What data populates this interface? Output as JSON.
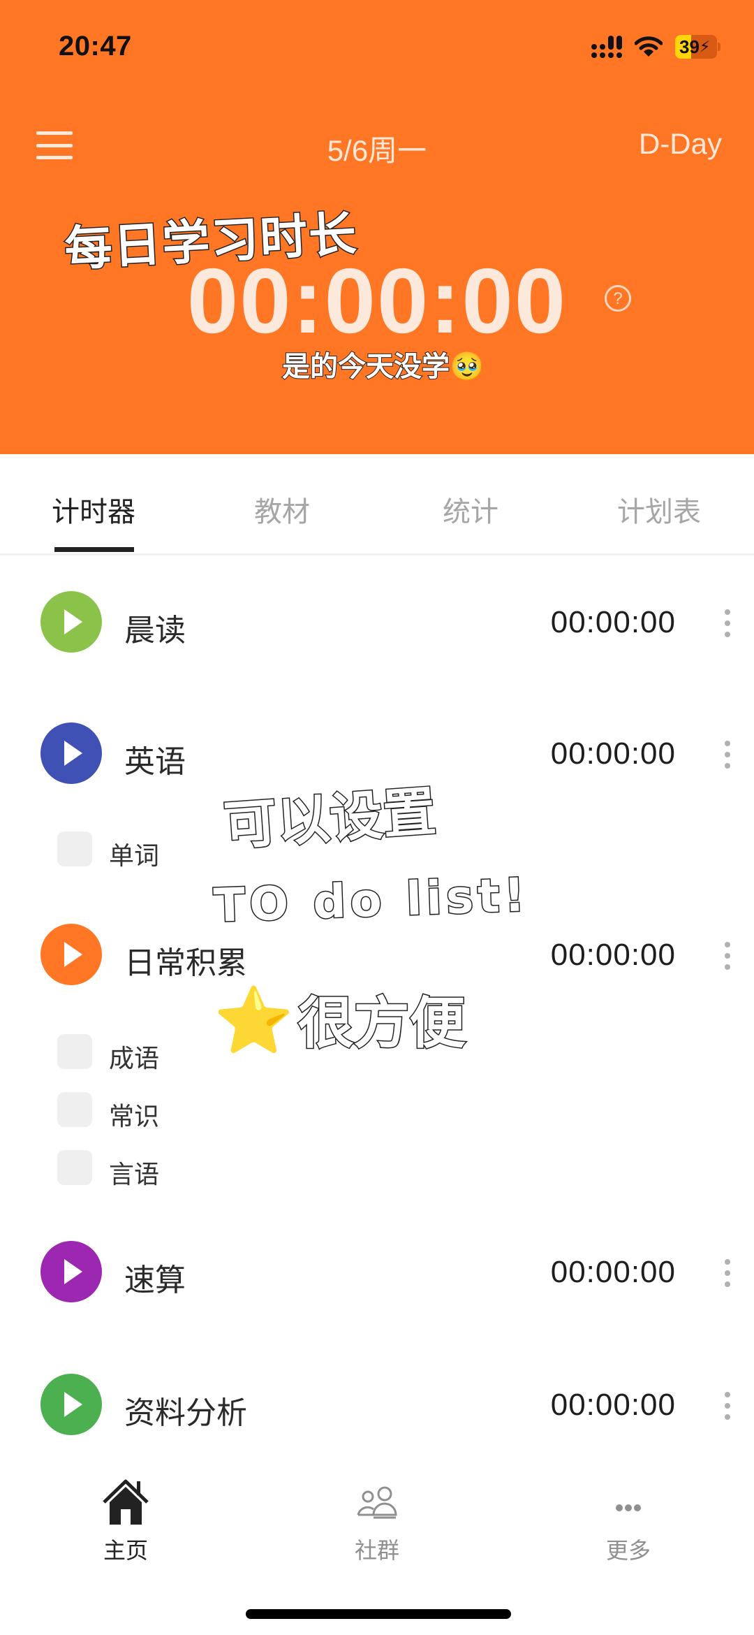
{
  "status_bar": {
    "time": "20:47",
    "battery_level": "39",
    "battery_fraction": 0.39,
    "signal_icon": "cellular-signal-icon",
    "wifi_icon": "wifi-icon",
    "charging_icon": "bolt-icon"
  },
  "header": {
    "menu_icon": "hamburger-menu-icon",
    "date_title": "5/6周一",
    "dday_label": "D-Day",
    "total_time": "00:00:00",
    "help_icon": "?",
    "background_color": "#FF7624"
  },
  "stickers": {
    "title": "每日学习时长",
    "subtitle": "是的今天没学🥹",
    "line1": "可以设置",
    "line2": "TO do list!",
    "star": "⭐",
    "line3": "很方便"
  },
  "tabs": [
    {
      "label": "计时器",
      "active": true
    },
    {
      "label": "教材",
      "active": false
    },
    {
      "label": "统计",
      "active": false
    },
    {
      "label": "计划表",
      "active": false
    }
  ],
  "tasks": [
    {
      "name": "晨读",
      "time": "00:00:00",
      "color": "#8BC34A",
      "subitems": []
    },
    {
      "name": "英语",
      "time": "00:00:00",
      "color": "#3F51B5",
      "subitems": [
        {
          "label": "单词",
          "checked": false
        }
      ]
    },
    {
      "name": "日常积累",
      "time": "00:00:00",
      "color": "#FF7624",
      "subitems": [
        {
          "label": "成语",
          "checked": false
        },
        {
          "label": "常识",
          "checked": false
        },
        {
          "label": "言语",
          "checked": false
        }
      ]
    },
    {
      "name": "速算",
      "time": "00:00:00",
      "color": "#9C27B0",
      "subitems": []
    },
    {
      "name": "资料分析",
      "time": "00:00:00",
      "color": "#4CAF50",
      "subitems": []
    }
  ],
  "bottom_nav": [
    {
      "label": "主页",
      "icon": "home-icon",
      "active": true
    },
    {
      "label": "社群",
      "icon": "community-icon",
      "active": false
    },
    {
      "label": "更多",
      "icon": "more-icon",
      "active": false
    }
  ]
}
